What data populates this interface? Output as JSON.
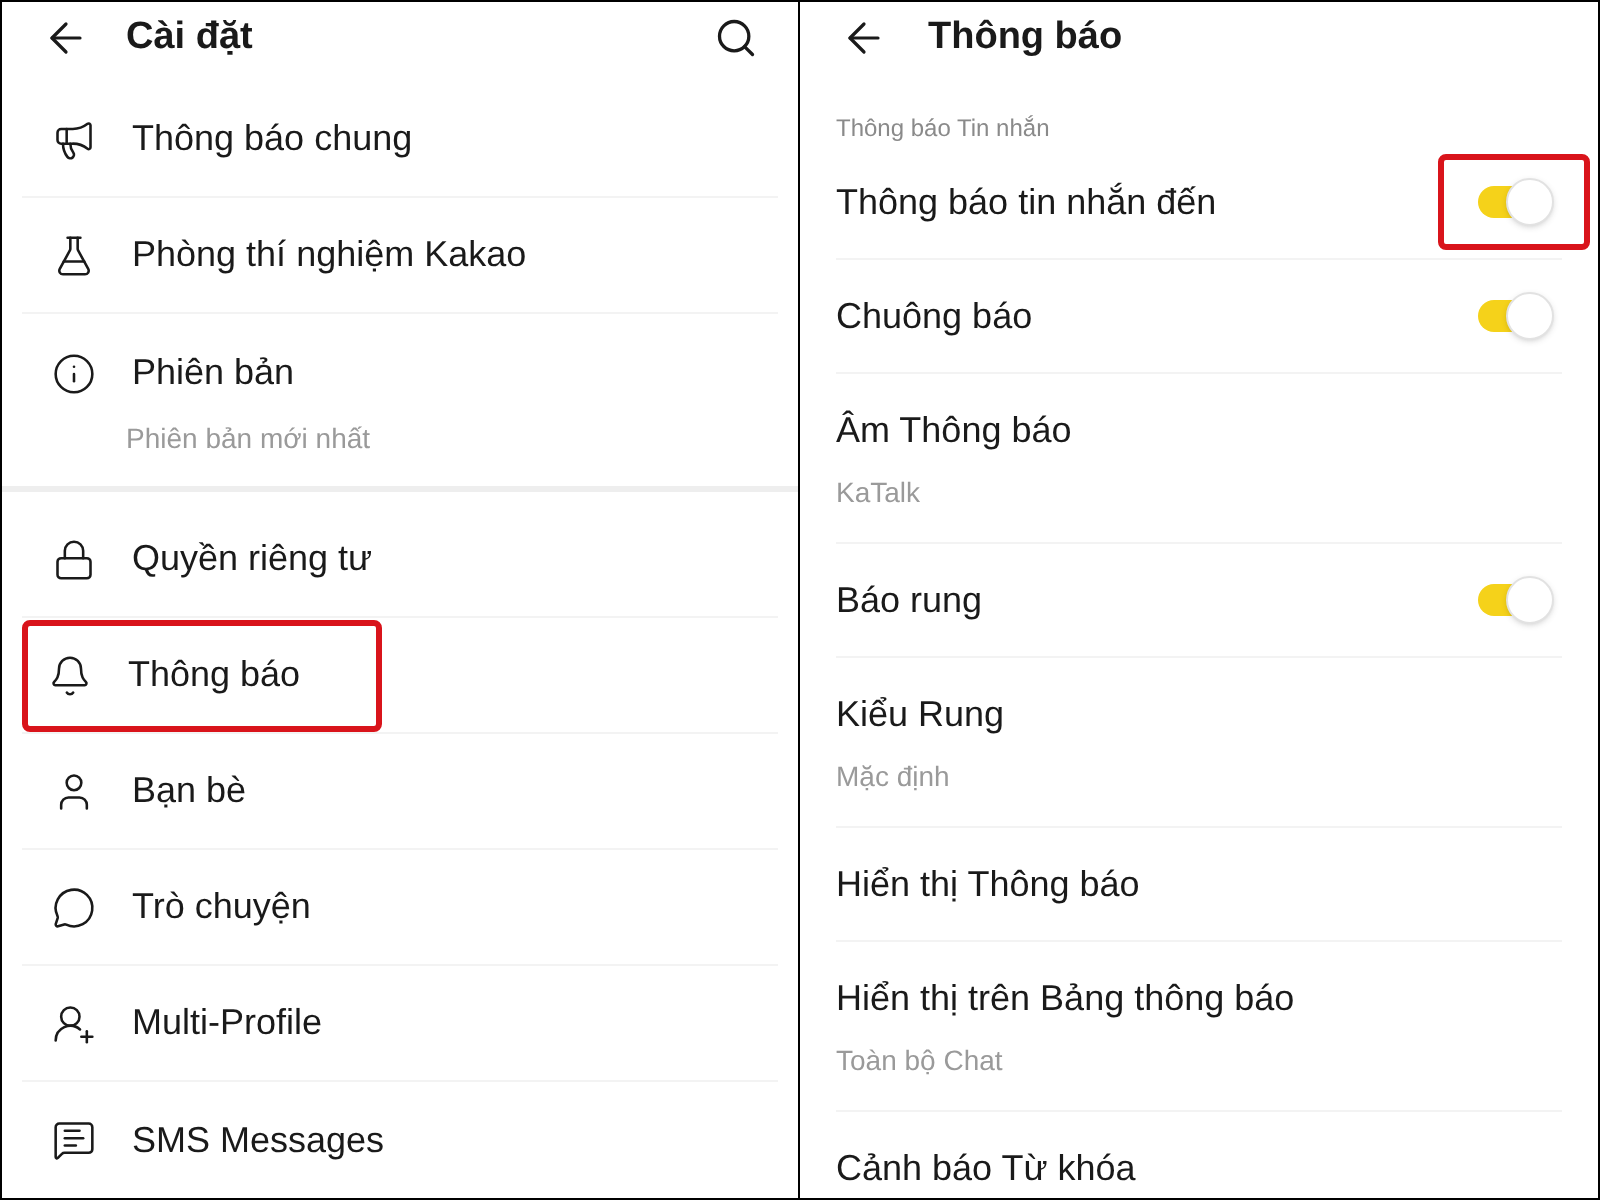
{
  "settings": {
    "title": "Cài đặt",
    "sections": [
      {
        "items": [
          {
            "label": "Thông báo chung",
            "highlighted": false
          },
          {
            "label": "Phòng thí nghiệm Kakao",
            "highlighted": false
          },
          {
            "label": "Phiên bản",
            "subtitle": "Phiên bản mới nhất",
            "highlighted": false
          }
        ]
      },
      {
        "items": [
          {
            "label": "Quyền riêng tư",
            "highlighted": false
          },
          {
            "label": "Thông báo",
            "highlighted": true
          },
          {
            "label": "Bạn bè",
            "highlighted": false
          },
          {
            "label": "Trò chuyện",
            "highlighted": false
          },
          {
            "label": "Multi-Profile",
            "highlighted": false
          },
          {
            "label": "SMS Messages",
            "highlighted": false
          }
        ]
      }
    ]
  },
  "notifications": {
    "title": "Thông báo",
    "section_label": "Thông báo Tin nhắn",
    "items": [
      {
        "kind": "toggle",
        "label": "Thông báo tin nhắn đến",
        "on": true,
        "highlighted": true
      },
      {
        "kind": "toggle",
        "label": "Chuông báo",
        "on": true,
        "highlighted": false
      },
      {
        "kind": "detail",
        "label": "Âm Thông báo",
        "subtitle": "KaTalk"
      },
      {
        "kind": "toggle",
        "label": "Báo rung",
        "on": true,
        "highlighted": false
      },
      {
        "kind": "detail",
        "label": "Kiểu Rung",
        "subtitle": "Mặc định"
      },
      {
        "kind": "detail",
        "label": "Hiển thị Thông báo"
      },
      {
        "kind": "detail",
        "label": "Hiển thị trên Bảng thông báo",
        "subtitle": "Toàn bộ Chat"
      },
      {
        "kind": "detail",
        "label": "Cảnh báo Từ khóa"
      }
    ]
  }
}
